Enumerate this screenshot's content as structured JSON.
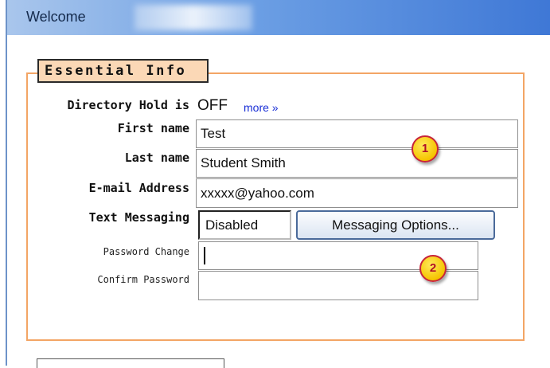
{
  "header": {
    "title": "Welcome"
  },
  "section": {
    "legend": "Essential Info"
  },
  "fields": {
    "directory_hold_label": "Directory Hold is",
    "directory_hold_value": "OFF",
    "more_link": "more »",
    "first_name_label": "First name",
    "first_name_value": "Test",
    "last_name_label": "Last name",
    "last_name_value": "Student Smith",
    "email_label": "E-mail Address",
    "email_value": "xxxxx@yahoo.com",
    "text_messaging_label": "Text Messaging",
    "text_messaging_value": "Disabled",
    "messaging_options_button": "Messaging Options...",
    "password_change_label": "Password Change",
    "password_change_value": "",
    "confirm_password_label": "Confirm Password",
    "confirm_password_value": ""
  },
  "callouts": [
    "1",
    "2"
  ],
  "colors": {
    "header_gradient_start": "#a9c6ec",
    "header_gradient_end": "#3f78d6",
    "fieldset_border": "#f3a565",
    "legend_background": "#fbd8b6",
    "link": "#1a2fd6",
    "callout_fill": "#f5c400",
    "callout_text": "#b10f26"
  }
}
